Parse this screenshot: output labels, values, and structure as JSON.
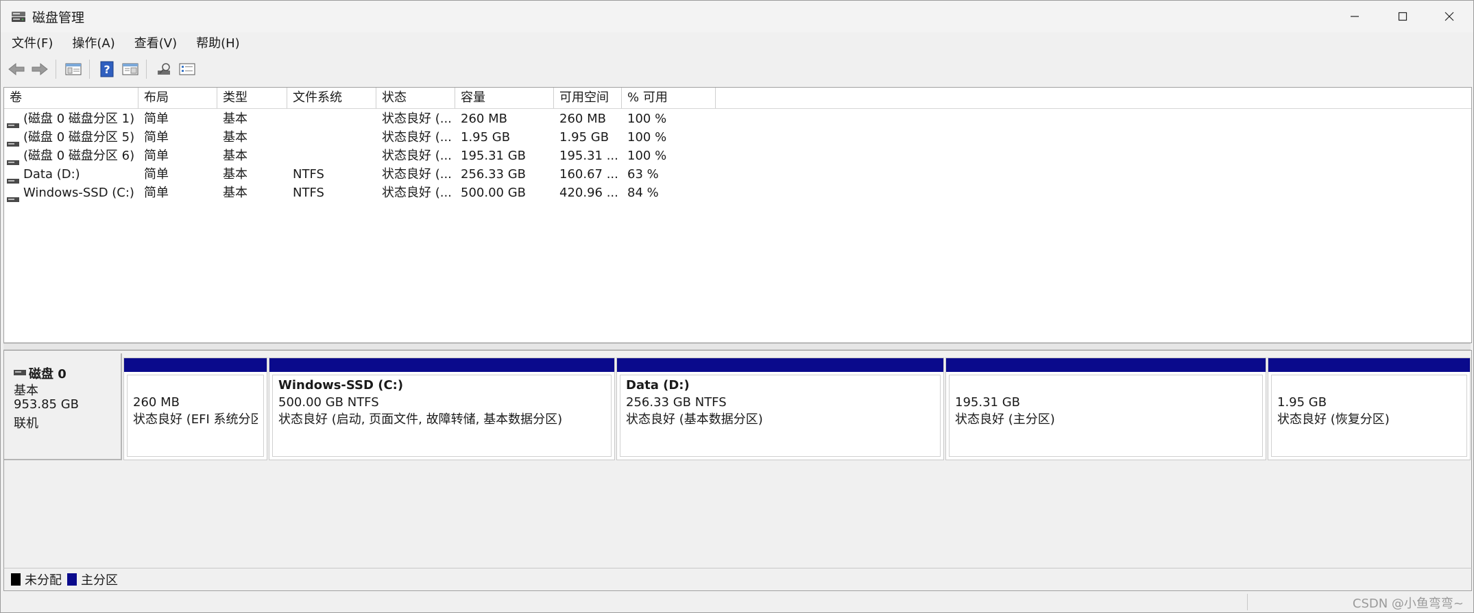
{
  "window": {
    "title": "磁盘管理",
    "icon": "disk-management-icon"
  },
  "menu": [
    "文件(F)",
    "操作(A)",
    "查看(V)",
    "帮助(H)"
  ],
  "toolbar": {
    "buttons": [
      "back-arrow-icon",
      "forward-arrow-icon",
      "console-tree-icon",
      "help-icon",
      "properties-view-icon",
      "rescan-icon",
      "settings-list-icon"
    ]
  },
  "volume_list": {
    "columns": [
      "卷",
      "布局",
      "类型",
      "文件系统",
      "状态",
      "容量",
      "可用空间",
      "% 可用"
    ],
    "rows": [
      [
        "(磁盘 0 磁盘分区 1)",
        "简单",
        "基本",
        "",
        "状态良好 (...",
        "260 MB",
        "260 MB",
        "100 %"
      ],
      [
        "(磁盘 0 磁盘分区 5)",
        "简单",
        "基本",
        "",
        "状态良好 (...",
        "1.95 GB",
        "1.95 GB",
        "100 %"
      ],
      [
        "(磁盘 0 磁盘分区 6)",
        "简单",
        "基本",
        "",
        "状态良好 (...",
        "195.31 GB",
        "195.31 ...",
        "100 %"
      ],
      [
        "Data (D:)",
        "简单",
        "基本",
        "NTFS",
        "状态良好 (...",
        "256.33 GB",
        "160.67 ...",
        "63 %"
      ],
      [
        "Windows-SSD (C:)",
        "简单",
        "基本",
        "NTFS",
        "状态良好 (...",
        "500.00 GB",
        "420.96 ...",
        "84 %"
      ]
    ]
  },
  "disk": {
    "name": "磁盘 0",
    "type": "基本",
    "size": "953.85 GB",
    "state": "联机",
    "partitions": [
      {
        "name": "",
        "size": "260 MB",
        "status": "状态良好 (EFI 系统分区)"
      },
      {
        "name": "Windows-SSD  (C:)",
        "size": "500.00 GB NTFS",
        "status": "状态良好 (启动, 页面文件, 故障转储, 基本数据分区)"
      },
      {
        "name": "Data  (D:)",
        "size": "256.33 GB NTFS",
        "status": "状态良好 (基本数据分区)"
      },
      {
        "name": "",
        "size": "195.31 GB",
        "status": "状态良好 (主分区)"
      },
      {
        "name": "",
        "size": "1.95 GB",
        "status": "状态良好 (恢复分区)"
      }
    ]
  },
  "legend": [
    {
      "label": "未分配",
      "color": "#000000"
    },
    {
      "label": "主分区",
      "color": "#0a0a8c"
    }
  ],
  "statusbar": {
    "watermark": "CSDN @小鱼弯弯~"
  },
  "colors": {
    "primary_partition": "#0a0a8c",
    "unallocated": "#000000"
  }
}
